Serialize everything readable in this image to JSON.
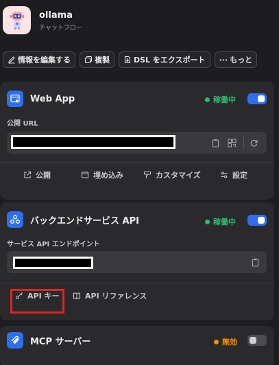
{
  "app": {
    "name": "ollama",
    "subtitle": "チャットフロー",
    "icon": "robot-avatar-icon"
  },
  "toolbar": {
    "edit_label": "情報を編集する",
    "duplicate_label": "複製",
    "export_label": "DSL をエクスポート",
    "more_label": "もっと"
  },
  "webapp": {
    "title": "Web App",
    "status": "稼働中",
    "status_color": "#2fb872",
    "toggle_on": true,
    "url_label": "公開 URL",
    "actions": {
      "publish": "公開",
      "embed": "埋め込み",
      "customize": "カスタマイズ",
      "settings": "設定"
    }
  },
  "backend": {
    "title": "バックエンドサービス API",
    "status": "稼働中",
    "status_color": "#2fb872",
    "toggle_on": true,
    "endpoint_label": "サービス API エンドポイント",
    "actions": {
      "api_key": "API キー",
      "api_reference": "API リファレンス"
    }
  },
  "mcp": {
    "title": "MCP サーバー",
    "status": "無効",
    "status_color": "#f79009",
    "toggle_on": false
  },
  "colors": {
    "accent": "#2f6fed",
    "highlight_box": "#e02424"
  }
}
